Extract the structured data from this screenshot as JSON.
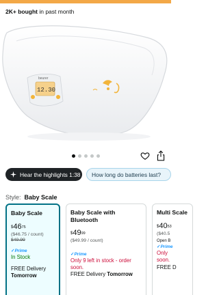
{
  "header": {
    "bought_bold": "2K+ bought",
    "bought_rest": " in past month",
    "accent_color": "#f3a847"
  },
  "product_image": {
    "brand": "beurer",
    "display_reading": "12.30",
    "icon": "baby-scale-product-photo"
  },
  "gallery": {
    "image_count": 5,
    "active_index": 0
  },
  "actions": {
    "favorite_icon": "heart-icon",
    "share_icon": "share-icon"
  },
  "pills": {
    "highlights": "Hear the highlights 1:38",
    "batteries": "How long do batteries last?"
  },
  "style": {
    "label": "Style:",
    "value": "Baby Scale"
  },
  "options": [
    {
      "title": "Baby Scale",
      "price_currency": "$",
      "price_whole": "46",
      "price_fraction": "75",
      "unit_price": "($46.75 / count)",
      "list_price": "$49.99",
      "prime": "Prime",
      "stock": "In Stock",
      "delivery_text": "FREE Delivery",
      "delivery_day": "Tomorrow"
    },
    {
      "title": "Baby Scale with Bluetooth",
      "price_currency": "$",
      "price_whole": "49",
      "price_fraction": "99",
      "unit_price": "($49.99 / count)",
      "prime": "Prime",
      "stock": "Only 9 left in stock - order soon.",
      "delivery_text": "FREE Delivery",
      "delivery_day": "Tomorrow"
    },
    {
      "title": "Multi Scale",
      "price_currency": "$",
      "price_whole": "40",
      "price_fraction": "53",
      "unit_price": "($40.5",
      "openbox": "Open B",
      "prime": "Prime",
      "stock": "Only",
      "stock2": "soon.",
      "delivery_text": "FREE D"
    }
  ]
}
